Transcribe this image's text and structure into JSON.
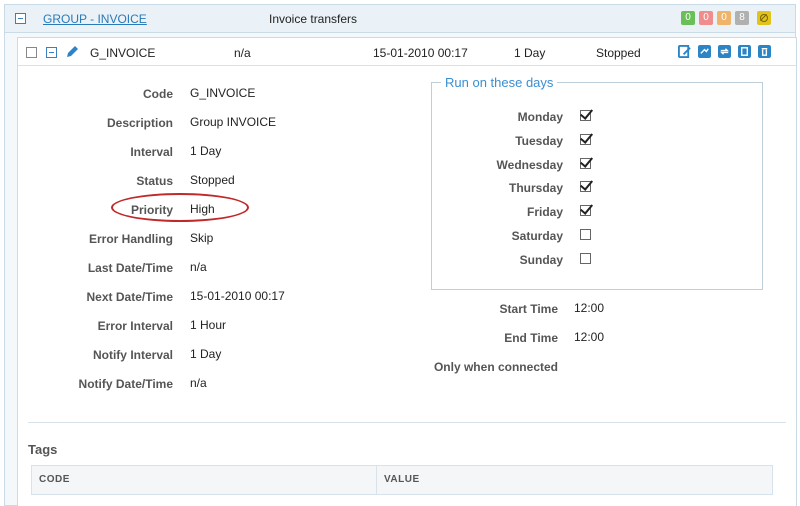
{
  "group": {
    "link": "GROUP - INVOICE",
    "description": "Invoice transfers",
    "counters": [
      {
        "value": "0",
        "color": "#6bbf59"
      },
      {
        "value": "0",
        "color": "#f08c8c"
      },
      {
        "value": "0",
        "color": "#f0b36a"
      },
      {
        "value": "8",
        "color": "#b0b0b0"
      }
    ],
    "ban_icon": "ban-icon"
  },
  "row": {
    "name": "G_INVOICE",
    "last_run": "n/a",
    "next_run": "15-01-2010 00:17",
    "interval": "1 Day",
    "status": "Stopped",
    "actions": [
      "edit-icon",
      "transfer-icon",
      "refresh-icon",
      "page-icon",
      "trash-icon"
    ]
  },
  "details": {
    "code_label": "Code",
    "code": "G_INVOICE",
    "description_label": "Description",
    "description": "Group INVOICE",
    "interval_label": "Interval",
    "interval": "1 Day",
    "status_label": "Status",
    "status": "Stopped",
    "priority_label": "Priority",
    "priority": "High",
    "error_handling_label": "Error Handling",
    "error_handling": "Skip",
    "last_datetime_label": "Last Date/Time",
    "last_datetime": "n/a",
    "next_datetime_label": "Next Date/Time",
    "next_datetime": "15-01-2010 00:17",
    "error_interval_label": "Error Interval",
    "error_interval": "1 Hour",
    "notify_interval_label": "Notify Interval",
    "notify_interval": "1 Day",
    "notify_datetime_label": "Notify Date/Time",
    "notify_datetime": "n/a"
  },
  "schedule": {
    "legend": "Run on these days",
    "days": [
      {
        "label": "Monday",
        "checked": true
      },
      {
        "label": "Tuesday",
        "checked": true
      },
      {
        "label": "Wednesday",
        "checked": true
      },
      {
        "label": "Thursday",
        "checked": true
      },
      {
        "label": "Friday",
        "checked": true
      },
      {
        "label": "Saturday",
        "checked": false
      },
      {
        "label": "Sunday",
        "checked": false
      }
    ],
    "start_time_label": "Start Time",
    "start_time": "12:00",
    "end_time_label": "End Time",
    "end_time": "12:00",
    "only_connected_label": "Only when connected"
  },
  "tags": {
    "title": "Tags",
    "columns": [
      "CODE",
      "VALUE"
    ]
  },
  "colors": {
    "accent": "#2b84c6",
    "highlight": "#c0282a"
  }
}
